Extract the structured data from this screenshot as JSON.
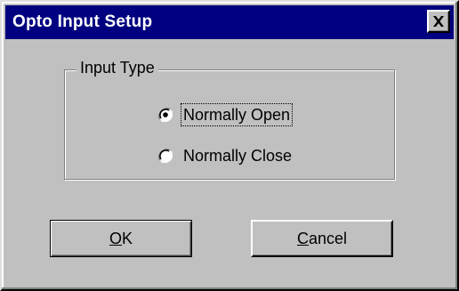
{
  "window": {
    "title": "Opto Input Setup",
    "close_icon": "close-x-icon"
  },
  "input_type_group": {
    "legend": "Input Type",
    "options": [
      {
        "label": "Normally Open",
        "selected": true
      },
      {
        "label": "Normally Close",
        "selected": false
      }
    ]
  },
  "buttons": {
    "ok": {
      "mnemonic": "O",
      "rest": "K"
    },
    "cancel": {
      "mnemonic": "C",
      "rest": "ancel"
    }
  },
  "colors": {
    "titlebar": "#000080",
    "face": "#c0c0c0"
  }
}
